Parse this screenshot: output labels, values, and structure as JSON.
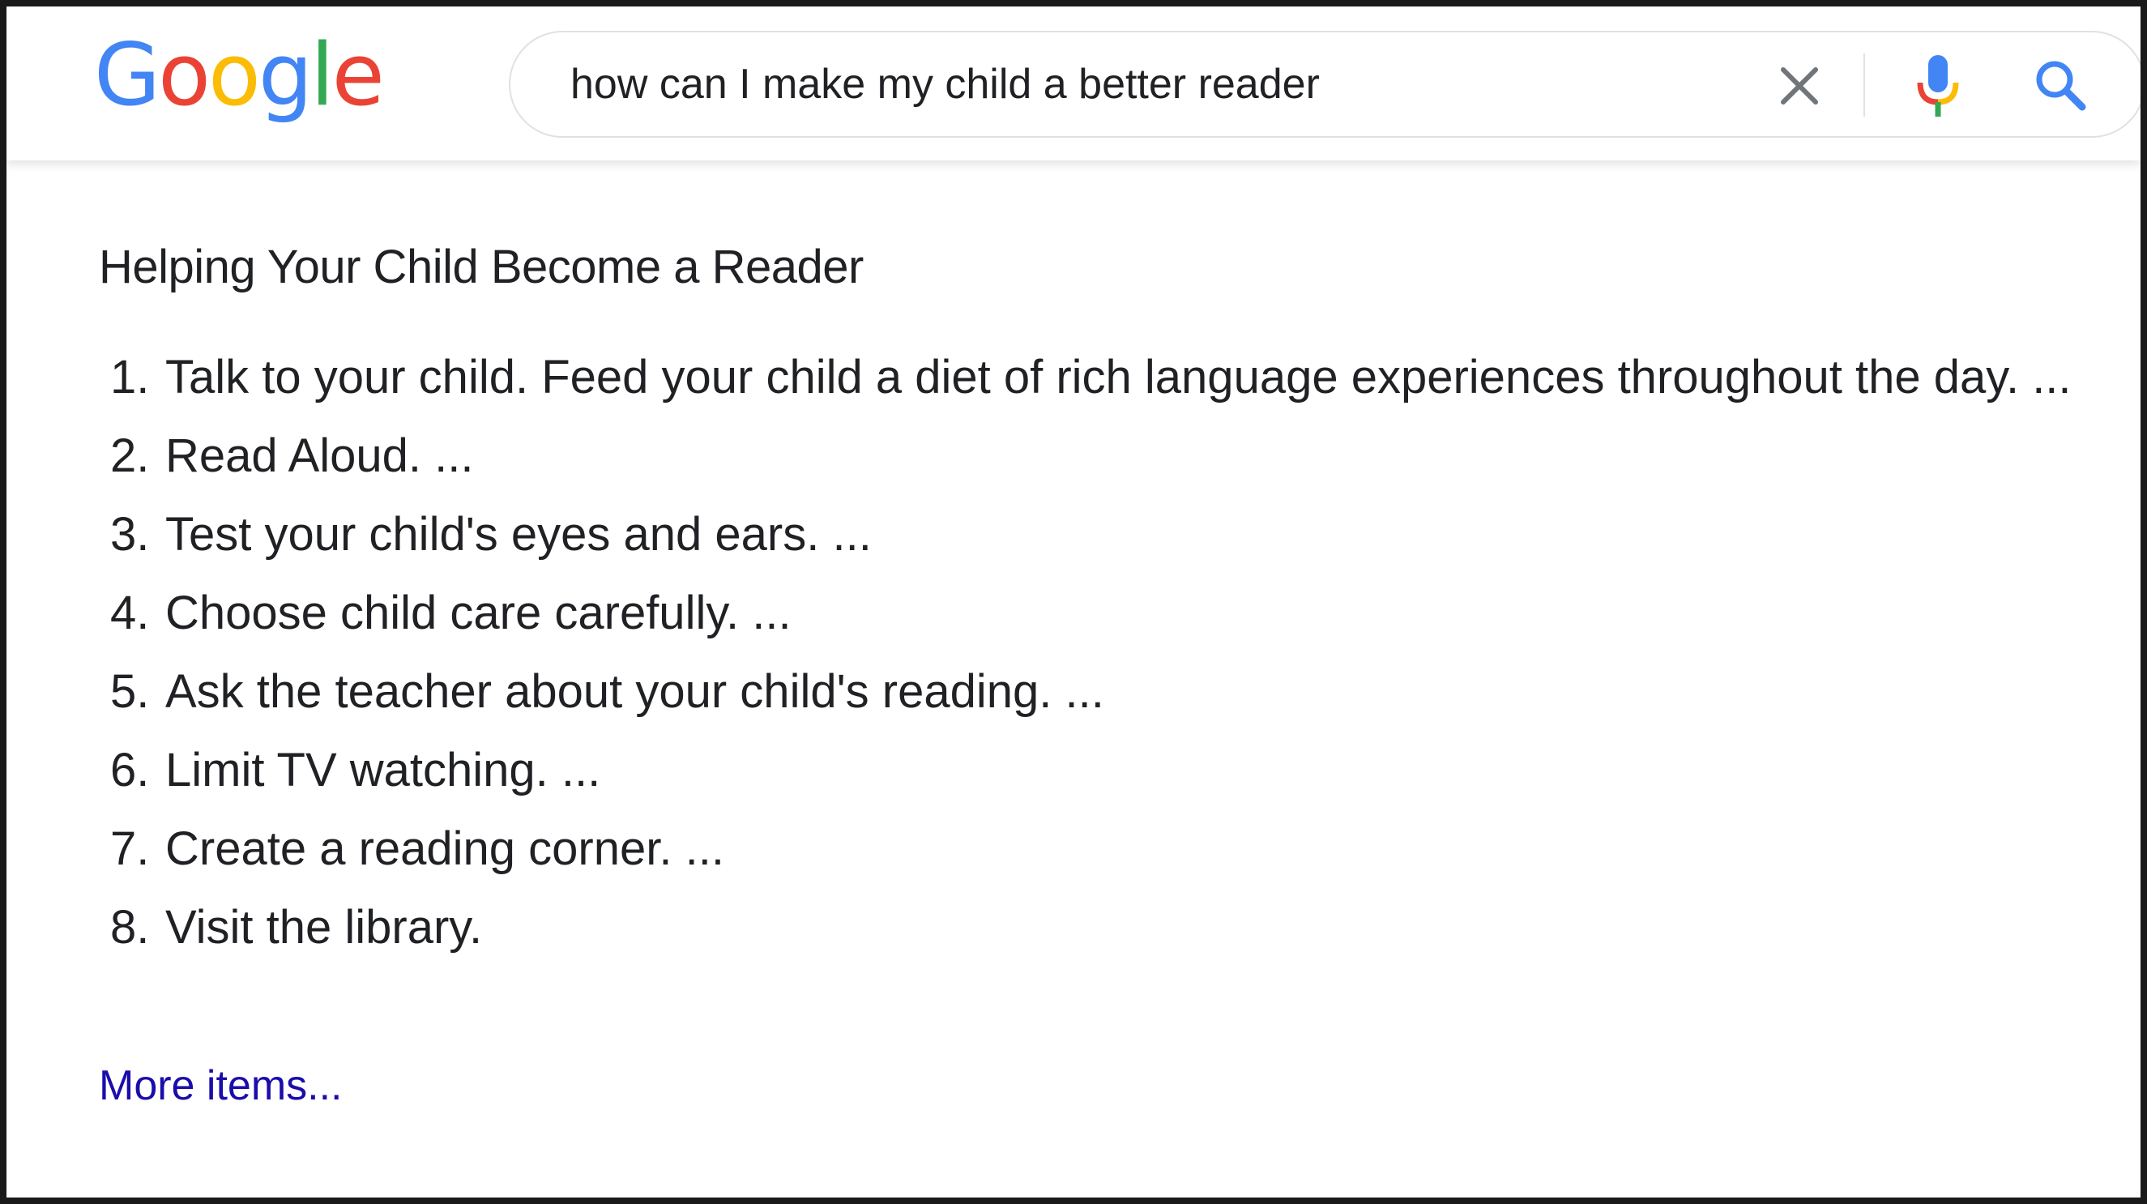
{
  "header": {
    "logo": {
      "letters": [
        "G",
        "o",
        "o",
        "g",
        "l",
        "e"
      ],
      "colors": [
        "#4285F4",
        "#EA4335",
        "#FBBC05",
        "#4285F4",
        "#34A853",
        "#EA4335"
      ]
    },
    "search": {
      "query": "how can I make my child a better reader",
      "clear_icon": "close-icon",
      "mic_icon": "microphone-icon",
      "search_icon": "search-icon"
    }
  },
  "snippet": {
    "title": "Helping Your Child Become a Reader",
    "items": [
      {
        "num": "1.",
        "text": "Talk to your child. Feed your child a diet of rich language experiences throughout the day. ..."
      },
      {
        "num": "2.",
        "text": "Read Aloud. ..."
      },
      {
        "num": "3.",
        "text": "Test your child's eyes and ears. ..."
      },
      {
        "num": "4.",
        "text": "Choose child care carefully. ..."
      },
      {
        "num": "5.",
        "text": "Ask the teacher about your child's reading. ..."
      },
      {
        "num": "6.",
        "text": "Limit TV watching. ..."
      },
      {
        "num": "7.",
        "text": "Create a reading corner. ..."
      },
      {
        "num": "8.",
        "text": "Visit the library."
      }
    ],
    "more_label": "More items...",
    "link_color": "#1a0dab"
  }
}
